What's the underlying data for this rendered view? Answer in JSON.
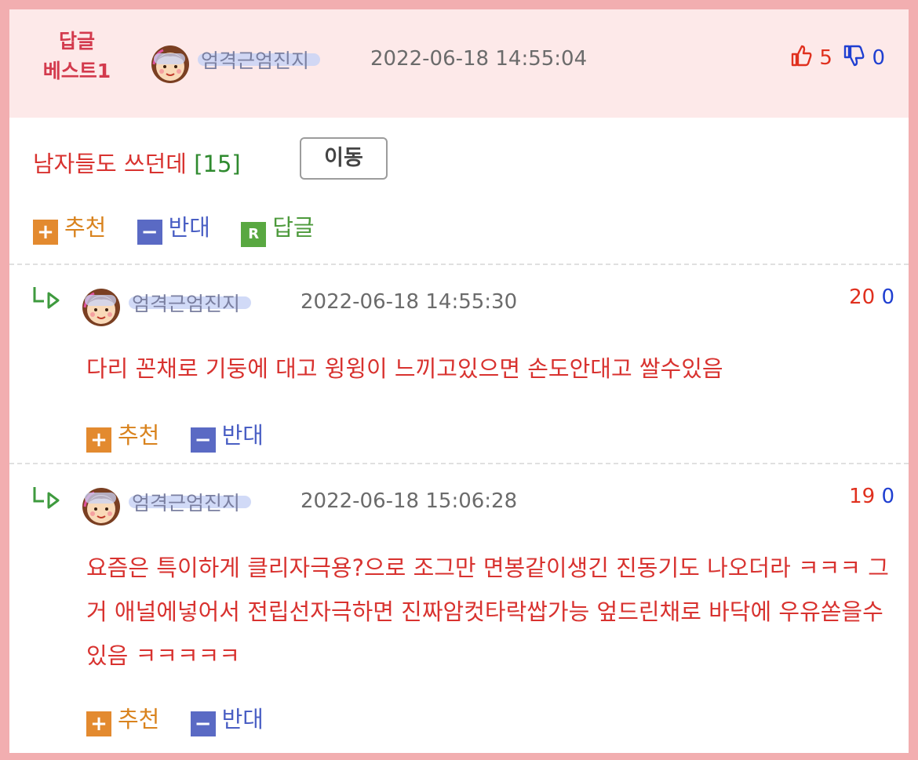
{
  "best": {
    "badge_line1": "답글",
    "badge_line2": "베스트1",
    "nickname": "엄격근엄진지",
    "datetime": "2022-06-18 14:55:04",
    "upvotes": "5",
    "downvotes": "0"
  },
  "post": {
    "title": "남자들도 쓰던데",
    "count": "[15]",
    "move_label": "이동"
  },
  "actions": {
    "recommend": "추천",
    "oppose": "반대",
    "reply": "답글",
    "reply_icon_letter": "R"
  },
  "replies": [
    {
      "nickname": "엄격근엄진지",
      "datetime": "2022-06-18 14:55:30",
      "upvotes": "20",
      "downvotes": "0",
      "text": "다리 꼰채로 기둥에 대고 윙윙이 느끼고있으면 손도안대고 쌀수있음"
    },
    {
      "nickname": "엄격근엄진지",
      "datetime": "2022-06-18 15:06:28",
      "upvotes": "19",
      "downvotes": "0",
      "text": "요즘은 특이하게 클리자극용?으로 조그만 면봉같이생긴 진동기도 나오더라 ㅋㅋㅋ 그거 애널에넣어서 전립선자극하면 진짜암컷타락쌉가능 엎드린채로 바닥에 우유쏟을수있음 ㅋㅋㅋㅋㅋ"
    }
  ],
  "colors": {
    "frame": "#f2aeb0",
    "header_bg": "#fde9e9",
    "accent_red": "#d8322f",
    "down_blue": "#1f3fd1"
  }
}
